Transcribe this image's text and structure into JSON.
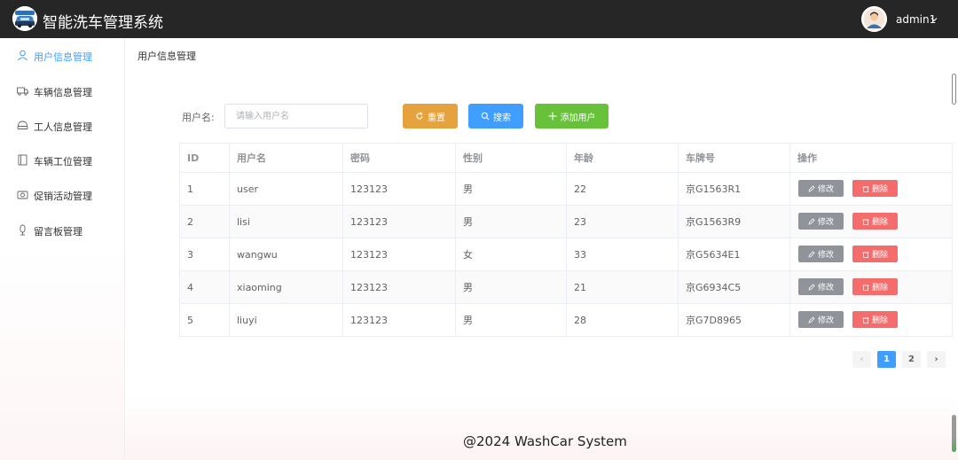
{
  "header": {
    "app_title": "智能洗车管理系统",
    "username": "admin1"
  },
  "sidebar": {
    "items": [
      {
        "label": "用户信息管理",
        "icon": "user-icon",
        "active": true
      },
      {
        "label": "车辆信息管理",
        "icon": "truck-icon",
        "active": false
      },
      {
        "label": "工人信息管理",
        "icon": "headset-icon",
        "active": false
      },
      {
        "label": "车辆工位管理",
        "icon": "document-icon",
        "active": false
      },
      {
        "label": "促销活动管理",
        "icon": "camera-icon",
        "active": false
      },
      {
        "label": "留言板管理",
        "icon": "microphone-icon",
        "active": false
      }
    ]
  },
  "breadcrumb": "用户信息管理",
  "search": {
    "label": "用户名:",
    "placeholder": "请输入用户名",
    "value": ""
  },
  "toolbar": {
    "reset_label": "重置",
    "search_label": "搜索",
    "add_label": "添加用户"
  },
  "table": {
    "columns": [
      "ID",
      "用户名",
      "密码",
      "性别",
      "年龄",
      "车牌号",
      "操作"
    ],
    "rows": [
      {
        "id": "1",
        "username": "user",
        "password": "123123",
        "gender": "男",
        "age": "22",
        "plate": "京G1563R1"
      },
      {
        "id": "2",
        "username": "lisi",
        "password": "123123",
        "gender": "男",
        "age": "23",
        "plate": "京G1563R9"
      },
      {
        "id": "3",
        "username": "wangwu",
        "password": "123123",
        "gender": "女",
        "age": "33",
        "plate": "京G5634E1"
      },
      {
        "id": "4",
        "username": "xiaoming",
        "password": "123123",
        "gender": "男",
        "age": "21",
        "plate": "京G6934C5"
      },
      {
        "id": "5",
        "username": "liuyi",
        "password": "123123",
        "gender": "男",
        "age": "28",
        "plate": "京G7D8965"
      }
    ],
    "edit_label": "修改",
    "delete_label": "删除"
  },
  "pagination": {
    "pages": [
      "1",
      "2"
    ],
    "current": "1",
    "prev": "‹",
    "next": "›"
  },
  "footer": "@2024 WashCar System",
  "colors": {
    "header_bg": "#262626",
    "primary": "#409eff",
    "warning": "#e6a23c",
    "success": "#67c23a",
    "danger": "#f56c6c",
    "info": "#909399"
  }
}
